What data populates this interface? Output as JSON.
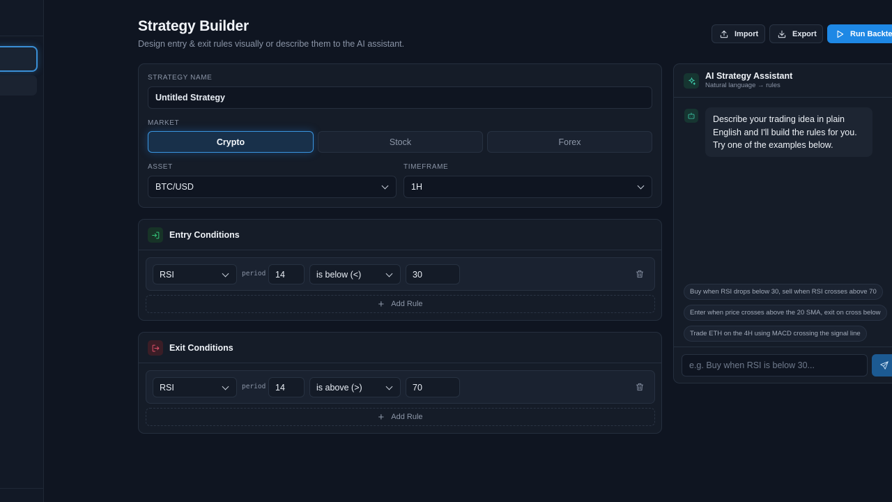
{
  "header": {
    "title": "Strategy Builder",
    "subtitle": "Design entry & exit rules visually or describe them to the AI assistant.",
    "import_label": "Import",
    "export_label": "Export",
    "run_label": "Run Backtest"
  },
  "strategy": {
    "name_label": "STRATEGY NAME",
    "name_value": "Untitled Strategy",
    "market_label": "MARKET",
    "markets": [
      "Crypto",
      "Stock",
      "Forex"
    ],
    "selected_market": "Crypto",
    "asset_label": "ASSET",
    "asset_value": "BTC/USD",
    "timeframe_label": "TIMEFRAME",
    "timeframe_value": "1H"
  },
  "entry": {
    "title": "Entry Conditions",
    "rule": {
      "indicator": "RSI",
      "period_label": "period",
      "period": "14",
      "operator": "is below (<)",
      "value": "30"
    },
    "add_label": "Add Rule"
  },
  "exit": {
    "title": "Exit Conditions",
    "rule": {
      "indicator": "RSI",
      "period_label": "period",
      "period": "14",
      "operator": "is above (>)",
      "value": "70"
    },
    "add_label": "Add Rule"
  },
  "ai": {
    "title": "AI Strategy Assistant",
    "subtitle": "Natural language → rules",
    "message": "Describe your trading idea in plain English and I'll build the rules for you. Try one of the examples below.",
    "examples": [
      "Buy when RSI drops below 30, sell when RSI crosses above 70",
      "Enter when price crosses above the 20 SMA, exit on cross below",
      "Trade ETH on the 4H using MACD crossing the signal line"
    ],
    "input_placeholder": "e.g. Buy when RSI is below 30..."
  },
  "colors": {
    "accent": "#1e88e5",
    "entry_green": "#34c77b",
    "exit_red": "#e0506a",
    "ai_teal": "#3fd0b0"
  }
}
